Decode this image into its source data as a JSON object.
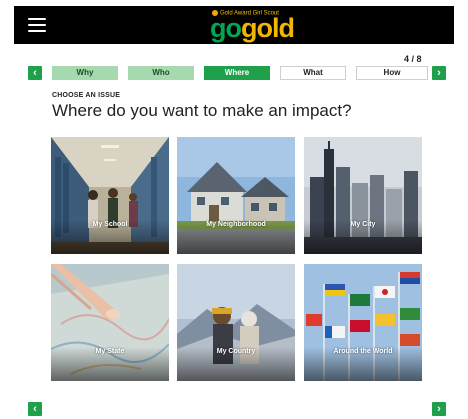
{
  "header": {
    "logo_tagline": "Gold Award Girl Scout",
    "logo_go": "go",
    "logo_gold": "gold"
  },
  "progress": {
    "counter": "4 / 8",
    "steps": [
      {
        "label": "Why",
        "state": "done"
      },
      {
        "label": "Who",
        "state": "done"
      },
      {
        "label": "Where",
        "state": "active"
      },
      {
        "label": "What",
        "state": "todo"
      },
      {
        "label": "How",
        "state": "todo"
      }
    ]
  },
  "content": {
    "eyebrow": "CHOOSE AN ISSUE",
    "heading": "Where do you want to make an impact?",
    "cards": [
      {
        "label": "My School"
      },
      {
        "label": "My Neighborhood"
      },
      {
        "label": "My City"
      },
      {
        "label": "My State"
      },
      {
        "label": "My Country"
      },
      {
        "label": "Around the World"
      }
    ]
  },
  "icons": {
    "prev": "chevron-left-icon",
    "next": "chevron-right-icon",
    "menu": "hamburger-menu-icon"
  },
  "colors": {
    "accent_green": "#1fa04a",
    "done_green": "#a6d9ae",
    "logo_gold": "#f2b600",
    "logo_green": "#00a651",
    "header_bg": "#000000"
  }
}
